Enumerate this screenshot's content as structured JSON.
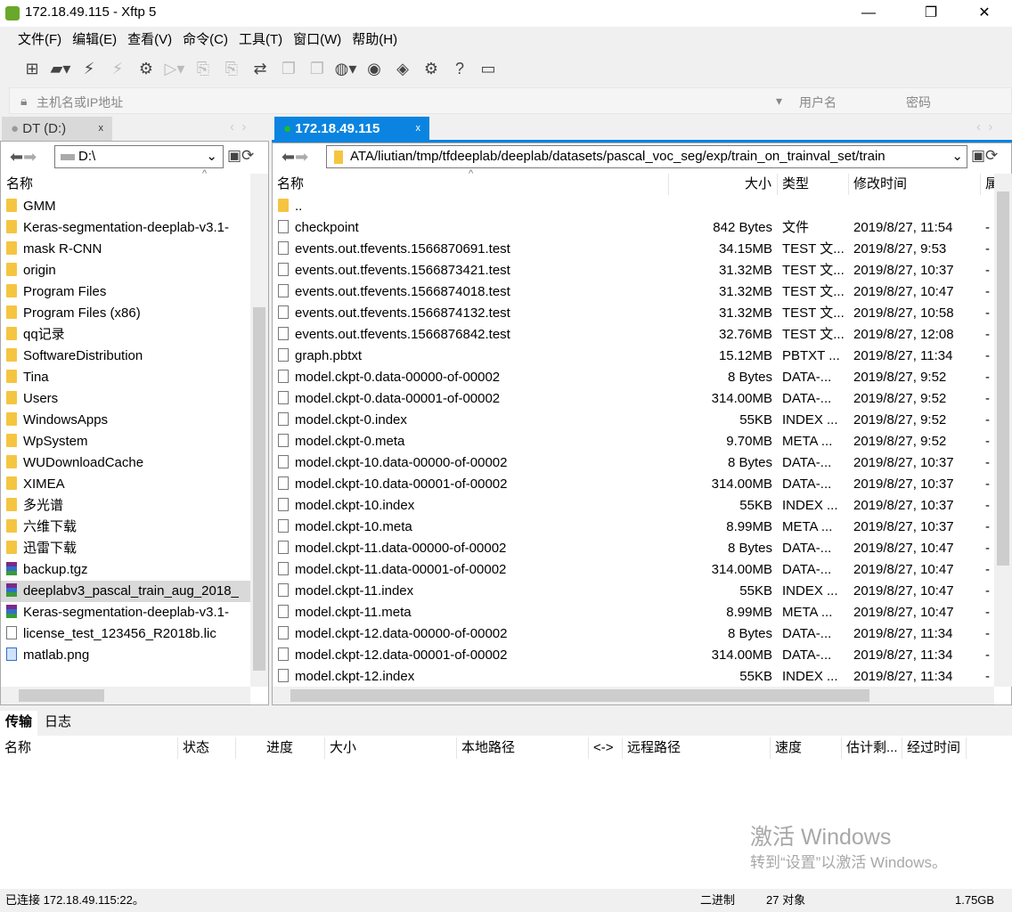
{
  "window": {
    "title": "172.18.49.115   - Xftp 5",
    "minimize": "—",
    "maximize": "❐",
    "close": "✕"
  },
  "menu": [
    "文件(F)",
    "编辑(E)",
    "查看(V)",
    "命令(C)",
    "工具(T)",
    "窗口(W)",
    "帮助(H)"
  ],
  "toolbar": [
    {
      "icon": "new-session-icon",
      "g": "⊞"
    },
    {
      "icon": "open-folder-icon",
      "g": "▰▾"
    },
    {
      "icon": "connect-icon",
      "g": "⚡"
    },
    {
      "icon": "disconnect-icon",
      "g": "⚡",
      "dis": true
    },
    {
      "icon": "properties-icon",
      "g": "⚙"
    },
    {
      "icon": "play-icon",
      "g": "▷▾",
      "dis": true
    },
    {
      "icon": "upload-icon",
      "g": "⎘",
      "dis": true
    },
    {
      "icon": "download-icon",
      "g": "⎘",
      "dis": true
    },
    {
      "icon": "transfer-icon",
      "g": "⇄"
    },
    {
      "icon": "copy-icon",
      "g": "❐",
      "dis": true
    },
    {
      "icon": "paste-icon",
      "g": "❐",
      "dis": true
    },
    {
      "icon": "globe-icon",
      "g": "◍▾"
    },
    {
      "icon": "xshell-icon",
      "g": "◉"
    },
    {
      "icon": "xftp-icon",
      "g": "◈"
    },
    {
      "icon": "settings-icon",
      "g": "⚙"
    },
    {
      "icon": "help-icon",
      "g": "?"
    },
    {
      "icon": "chat-icon",
      "g": "▭"
    }
  ],
  "address": {
    "host_placeholder": "主机名或IP地址",
    "user_placeholder": "用户名",
    "password_placeholder": "密码"
  },
  "left": {
    "tab": "DT (D:)",
    "path": "D:\\",
    "header": "名称",
    "items": [
      [
        "GMM",
        "folder"
      ],
      [
        "Keras-segmentation-deeplab-v3.1-",
        "folder"
      ],
      [
        "mask R-CNN",
        "folder"
      ],
      [
        "origin",
        "folder"
      ],
      [
        "Program Files",
        "folder"
      ],
      [
        "Program Files (x86)",
        "folder"
      ],
      [
        "qq记录",
        "folder"
      ],
      [
        "SoftwareDistribution",
        "folder"
      ],
      [
        "Tina",
        "folder"
      ],
      [
        "Users",
        "folder"
      ],
      [
        "WindowsApps",
        "folder"
      ],
      [
        "WpSystem",
        "folder"
      ],
      [
        "WUDownloadCache",
        "folder"
      ],
      [
        "XIMEA",
        "folder"
      ],
      [
        "多光谱",
        "folder"
      ],
      [
        "六维下载",
        "folder"
      ],
      [
        "迅雷下载",
        "folder"
      ],
      [
        "backup.tgz",
        "arch"
      ],
      [
        "deeplabv3_pascal_train_aug_2018_",
        "arch"
      ],
      [
        "Keras-segmentation-deeplab-v3.1-",
        "arch"
      ],
      [
        "license_test_123456_R2018b.lic",
        "file"
      ],
      [
        "matlab.png",
        "img"
      ]
    ],
    "selected": 18
  },
  "right": {
    "tab": "172.18.49.115",
    "path": "ATA/liutian/tmp/tfdeeplab/deeplab/datasets/pascal_voc_seg/exp/train_on_trainval_set/train",
    "headers": [
      "名称",
      "大小",
      "类型",
      "修改时间",
      "属"
    ],
    "items": [
      [
        "..",
        "",
        "",
        "",
        "",
        "folder"
      ],
      [
        "checkpoint",
        "842 Bytes",
        "文件",
        "2019/8/27, 11:54",
        "-",
        "file"
      ],
      [
        "events.out.tfevents.1566870691.test",
        "34.15MB",
        "TEST 文...",
        "2019/8/27, 9:53",
        "-",
        "file"
      ],
      [
        "events.out.tfevents.1566873421.test",
        "31.32MB",
        "TEST 文...",
        "2019/8/27, 10:37",
        "-",
        "file"
      ],
      [
        "events.out.tfevents.1566874018.test",
        "31.32MB",
        "TEST 文...",
        "2019/8/27, 10:47",
        "-",
        "file"
      ],
      [
        "events.out.tfevents.1566874132.test",
        "31.32MB",
        "TEST 文...",
        "2019/8/27, 10:58",
        "-",
        "file"
      ],
      [
        "events.out.tfevents.1566876842.test",
        "32.76MB",
        "TEST 文...",
        "2019/8/27, 12:08",
        "-",
        "file"
      ],
      [
        "graph.pbtxt",
        "15.12MB",
        "PBTXT ...",
        "2019/8/27, 11:34",
        "-",
        "file"
      ],
      [
        "model.ckpt-0.data-00000-of-00002",
        "8 Bytes",
        "DATA-...",
        "2019/8/27, 9:52",
        "-",
        "file"
      ],
      [
        "model.ckpt-0.data-00001-of-00002",
        "314.00MB",
        "DATA-...",
        "2019/8/27, 9:52",
        "-",
        "file"
      ],
      [
        "model.ckpt-0.index",
        "55KB",
        "INDEX ...",
        "2019/8/27, 9:52",
        "-",
        "file"
      ],
      [
        "model.ckpt-0.meta",
        "9.70MB",
        "META ...",
        "2019/8/27, 9:52",
        "-",
        "file"
      ],
      [
        "model.ckpt-10.data-00000-of-00002",
        "8 Bytes",
        "DATA-...",
        "2019/8/27, 10:37",
        "-",
        "file"
      ],
      [
        "model.ckpt-10.data-00001-of-00002",
        "314.00MB",
        "DATA-...",
        "2019/8/27, 10:37",
        "-",
        "file"
      ],
      [
        "model.ckpt-10.index",
        "55KB",
        "INDEX ...",
        "2019/8/27, 10:37",
        "-",
        "file"
      ],
      [
        "model.ckpt-10.meta",
        "8.99MB",
        "META ...",
        "2019/8/27, 10:37",
        "-",
        "file"
      ],
      [
        "model.ckpt-11.data-00000-of-00002",
        "8 Bytes",
        "DATA-...",
        "2019/8/27, 10:47",
        "-",
        "file"
      ],
      [
        "model.ckpt-11.data-00001-of-00002",
        "314.00MB",
        "DATA-...",
        "2019/8/27, 10:47",
        "-",
        "file"
      ],
      [
        "model.ckpt-11.index",
        "55KB",
        "INDEX ...",
        "2019/8/27, 10:47",
        "-",
        "file"
      ],
      [
        "model.ckpt-11.meta",
        "8.99MB",
        "META ...",
        "2019/8/27, 10:47",
        "-",
        "file"
      ],
      [
        "model.ckpt-12.data-00000-of-00002",
        "8 Bytes",
        "DATA-...",
        "2019/8/27, 11:34",
        "-",
        "file"
      ],
      [
        "model.ckpt-12.data-00001-of-00002",
        "314.00MB",
        "DATA-...",
        "2019/8/27, 11:34",
        "-",
        "file"
      ],
      [
        "model.ckpt-12.index",
        "55KB",
        "INDEX ...",
        "2019/8/27, 11:34",
        "-",
        "file"
      ]
    ]
  },
  "transfer": {
    "tabs": [
      "传输",
      "日志"
    ],
    "headers": [
      "名称",
      "状态",
      "进度",
      "大小",
      "本地路径",
      "<->",
      "远程路径",
      "速度",
      "估计剩...",
      "经过时间"
    ]
  },
  "watermark": {
    "line1": "激活 Windows",
    "line2": "转到“设置”以激活 Windows。"
  },
  "status": {
    "connection": "已连接 172.18.49.115:22。",
    "mode": "二进制",
    "count": "27 对象",
    "size": "1.75GB"
  },
  "colors": {
    "accent": "#0078d7",
    "online": "#1fbf1f"
  }
}
